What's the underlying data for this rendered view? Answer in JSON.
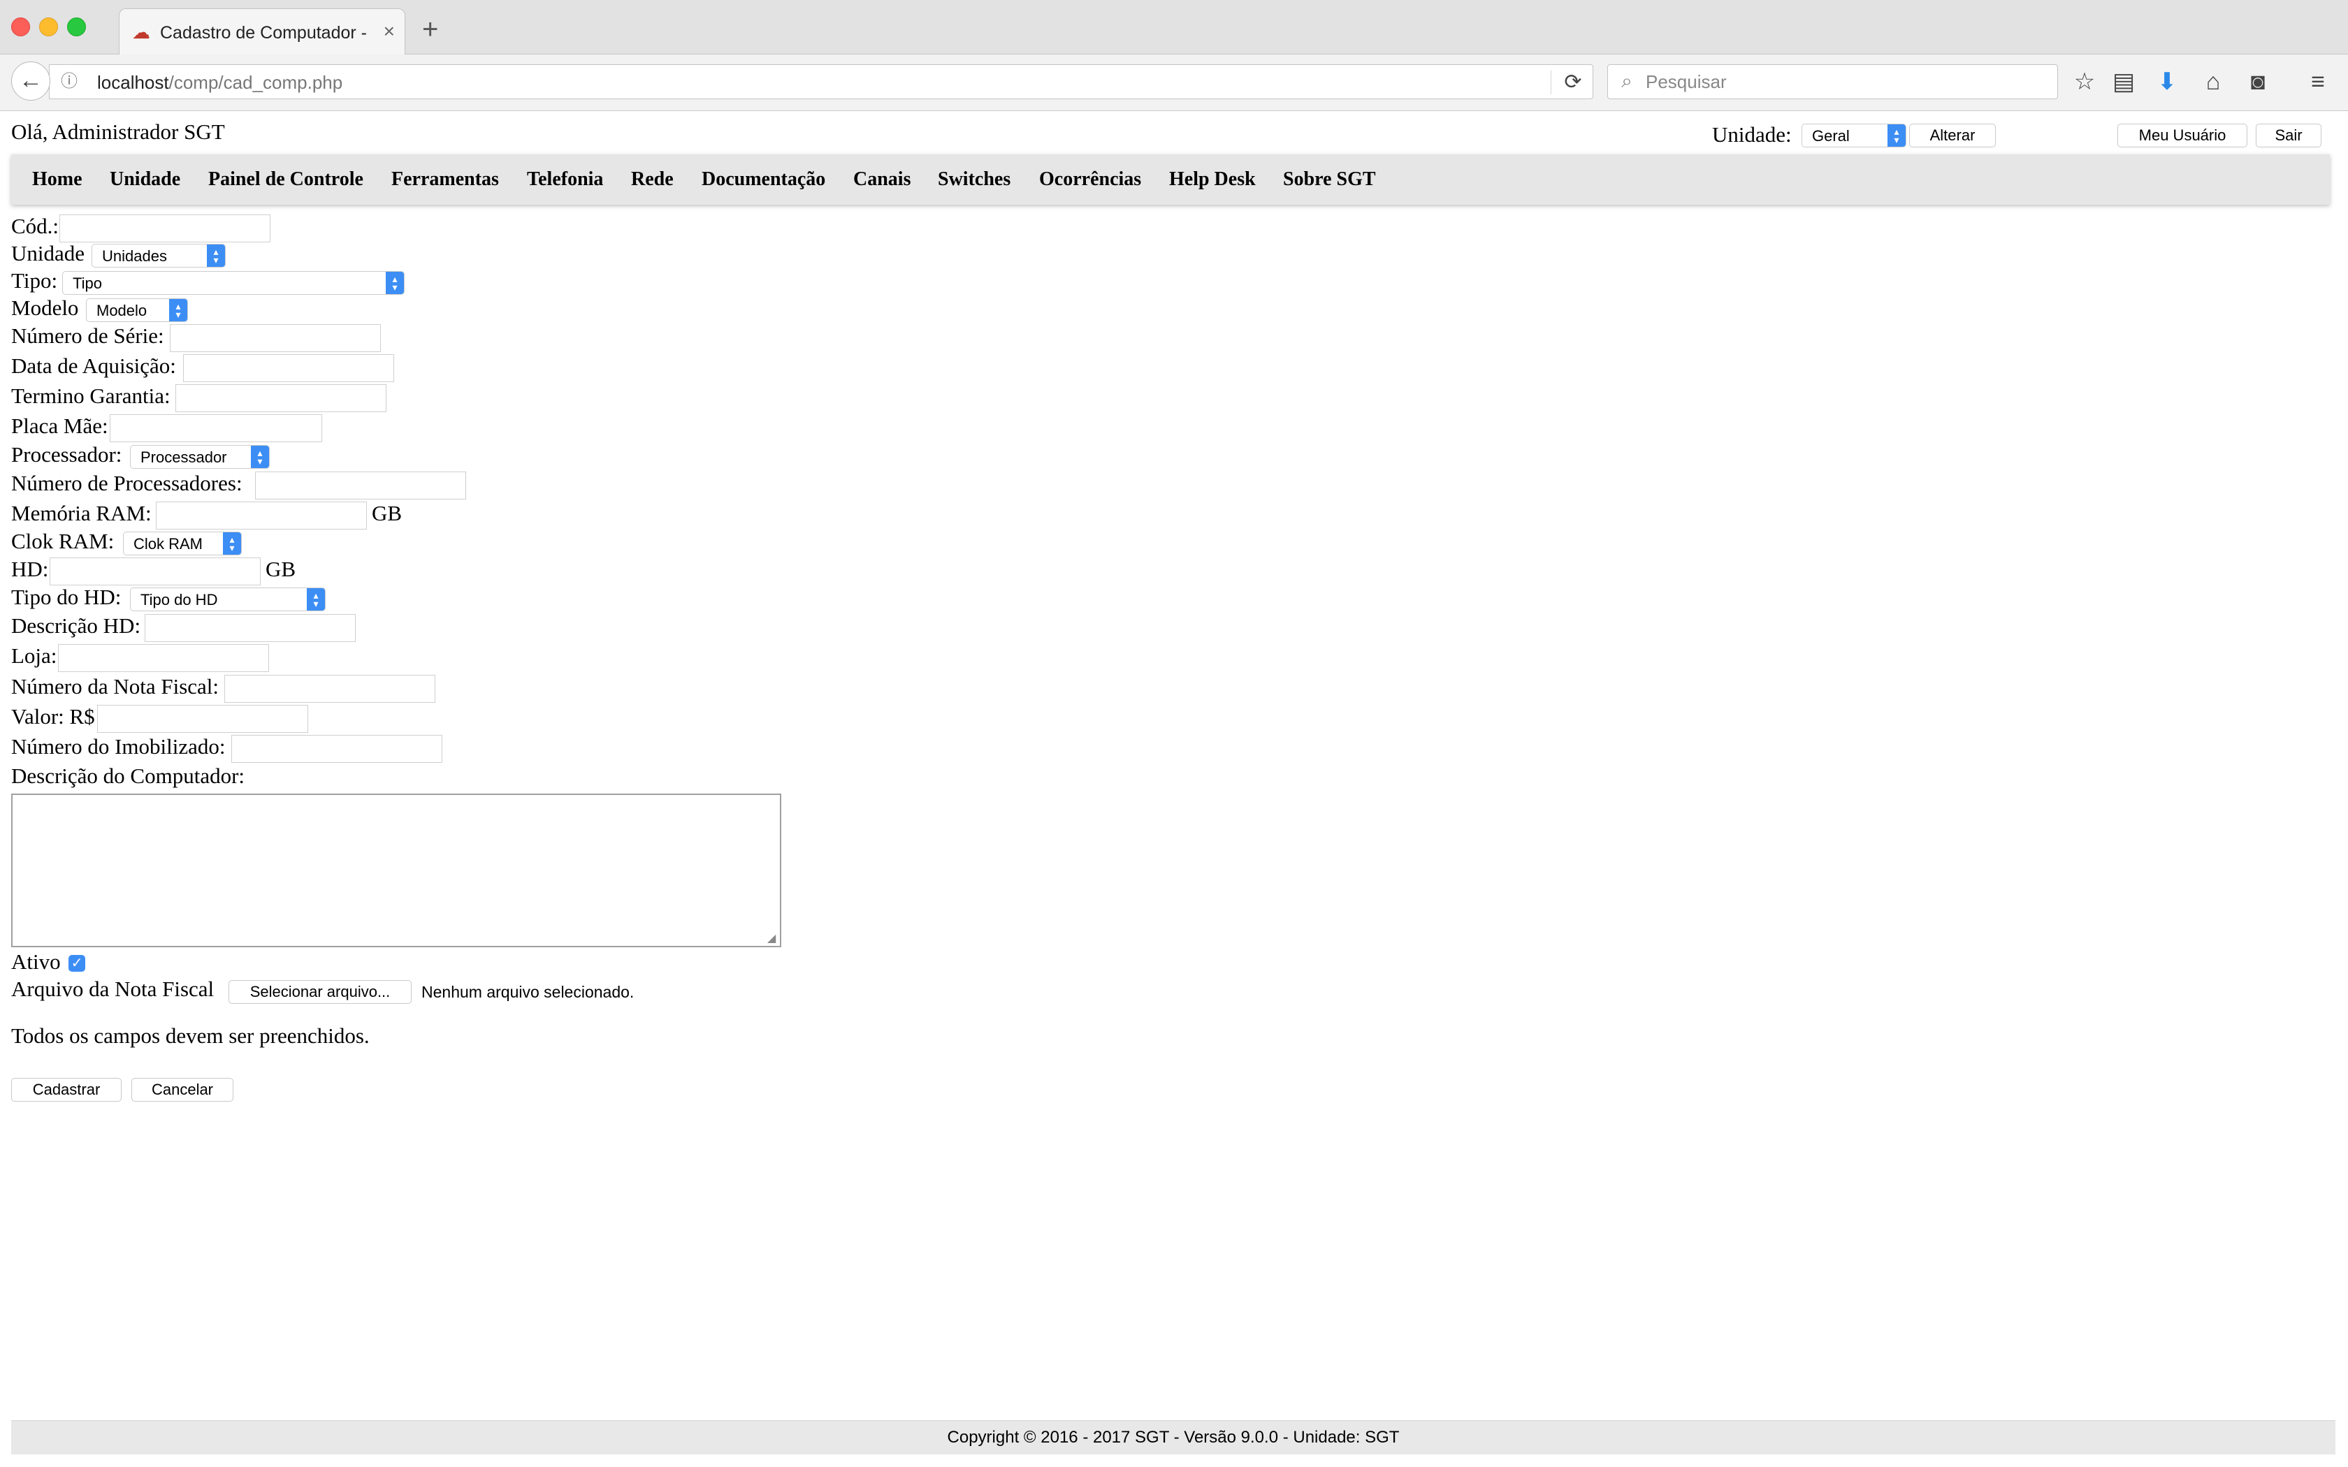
{
  "browser": {
    "tab_title": "Cadastro de Computador - SGT",
    "tab_close": "×",
    "new_tab": "+",
    "url_host": "localhost",
    "url_path": "/comp/cad_comp.php",
    "search_placeholder": "Pesquisar",
    "icons": {
      "back": "←",
      "info": "ⓘ",
      "reload": "⟳",
      "search": "⌕",
      "bookmark": "☆",
      "reader": "▤",
      "download": "⬇",
      "home": "⌂",
      "pocket": "◙",
      "menu": "≡"
    }
  },
  "header": {
    "greeting": "Olá, Administrador SGT",
    "unit_label": "Unidade:",
    "unit_value": "Geral",
    "change_button": "Alterar",
    "my_user_button": "Meu Usuário",
    "logout_button": "Sair"
  },
  "menu": [
    "Home",
    "Unidade",
    "Painel de Controle",
    "Ferramentas",
    "Telefonia",
    "Rede",
    "Documentação",
    "Canais",
    "Switches",
    "Ocorrências",
    "Help Desk",
    "Sobre SGT"
  ],
  "form": {
    "cod": "Cód.:",
    "unidade": "Unidade",
    "unidade_select": "Unidades",
    "tipo": "Tipo:",
    "tipo_select": "Tipo",
    "modelo": "Modelo",
    "modelo_select": "Modelo",
    "numero_serie": "Número de Série:",
    "data_aquisicao": "Data de Aquisição:",
    "termino_garantia": "Termino Garantia:",
    "placa_mae": "Placa Mãe:",
    "processador": "Processador:",
    "processador_select": "Processador",
    "num_processadores": "Número de Processadores:",
    "memoria_ram": "Memória RAM:",
    "gb_unit": "GB",
    "clok_ram": "Clok RAM:",
    "clok_ram_select": "Clok RAM",
    "hd": "HD:",
    "tipo_hd": "Tipo do HD:",
    "tipo_hd_select": "Tipo do HD",
    "descricao_hd": "Descrição HD:",
    "loja": "Loja:",
    "nota_fiscal": "Número da Nota Fiscal:",
    "valor": "Valor: R$",
    "imobilizado": "Número do Imobilizado:",
    "descricao_computador": "Descrição do Computador:",
    "ativo": "Ativo",
    "ativo_checked": true,
    "arquivo_nf": "Arquivo da Nota Fiscal",
    "file_button": "Selecionar arquivo...",
    "no_file": "Nenhum arquivo selecionado.",
    "notice": "Todos os campos devem ser preenchidos.",
    "submit_button": "Cadastrar",
    "cancel_button": "Cancelar"
  },
  "footer": {
    "text": "Copyright © 2016 - 2017 SGT - Versão 9.0.0 - Unidade: SGT"
  }
}
